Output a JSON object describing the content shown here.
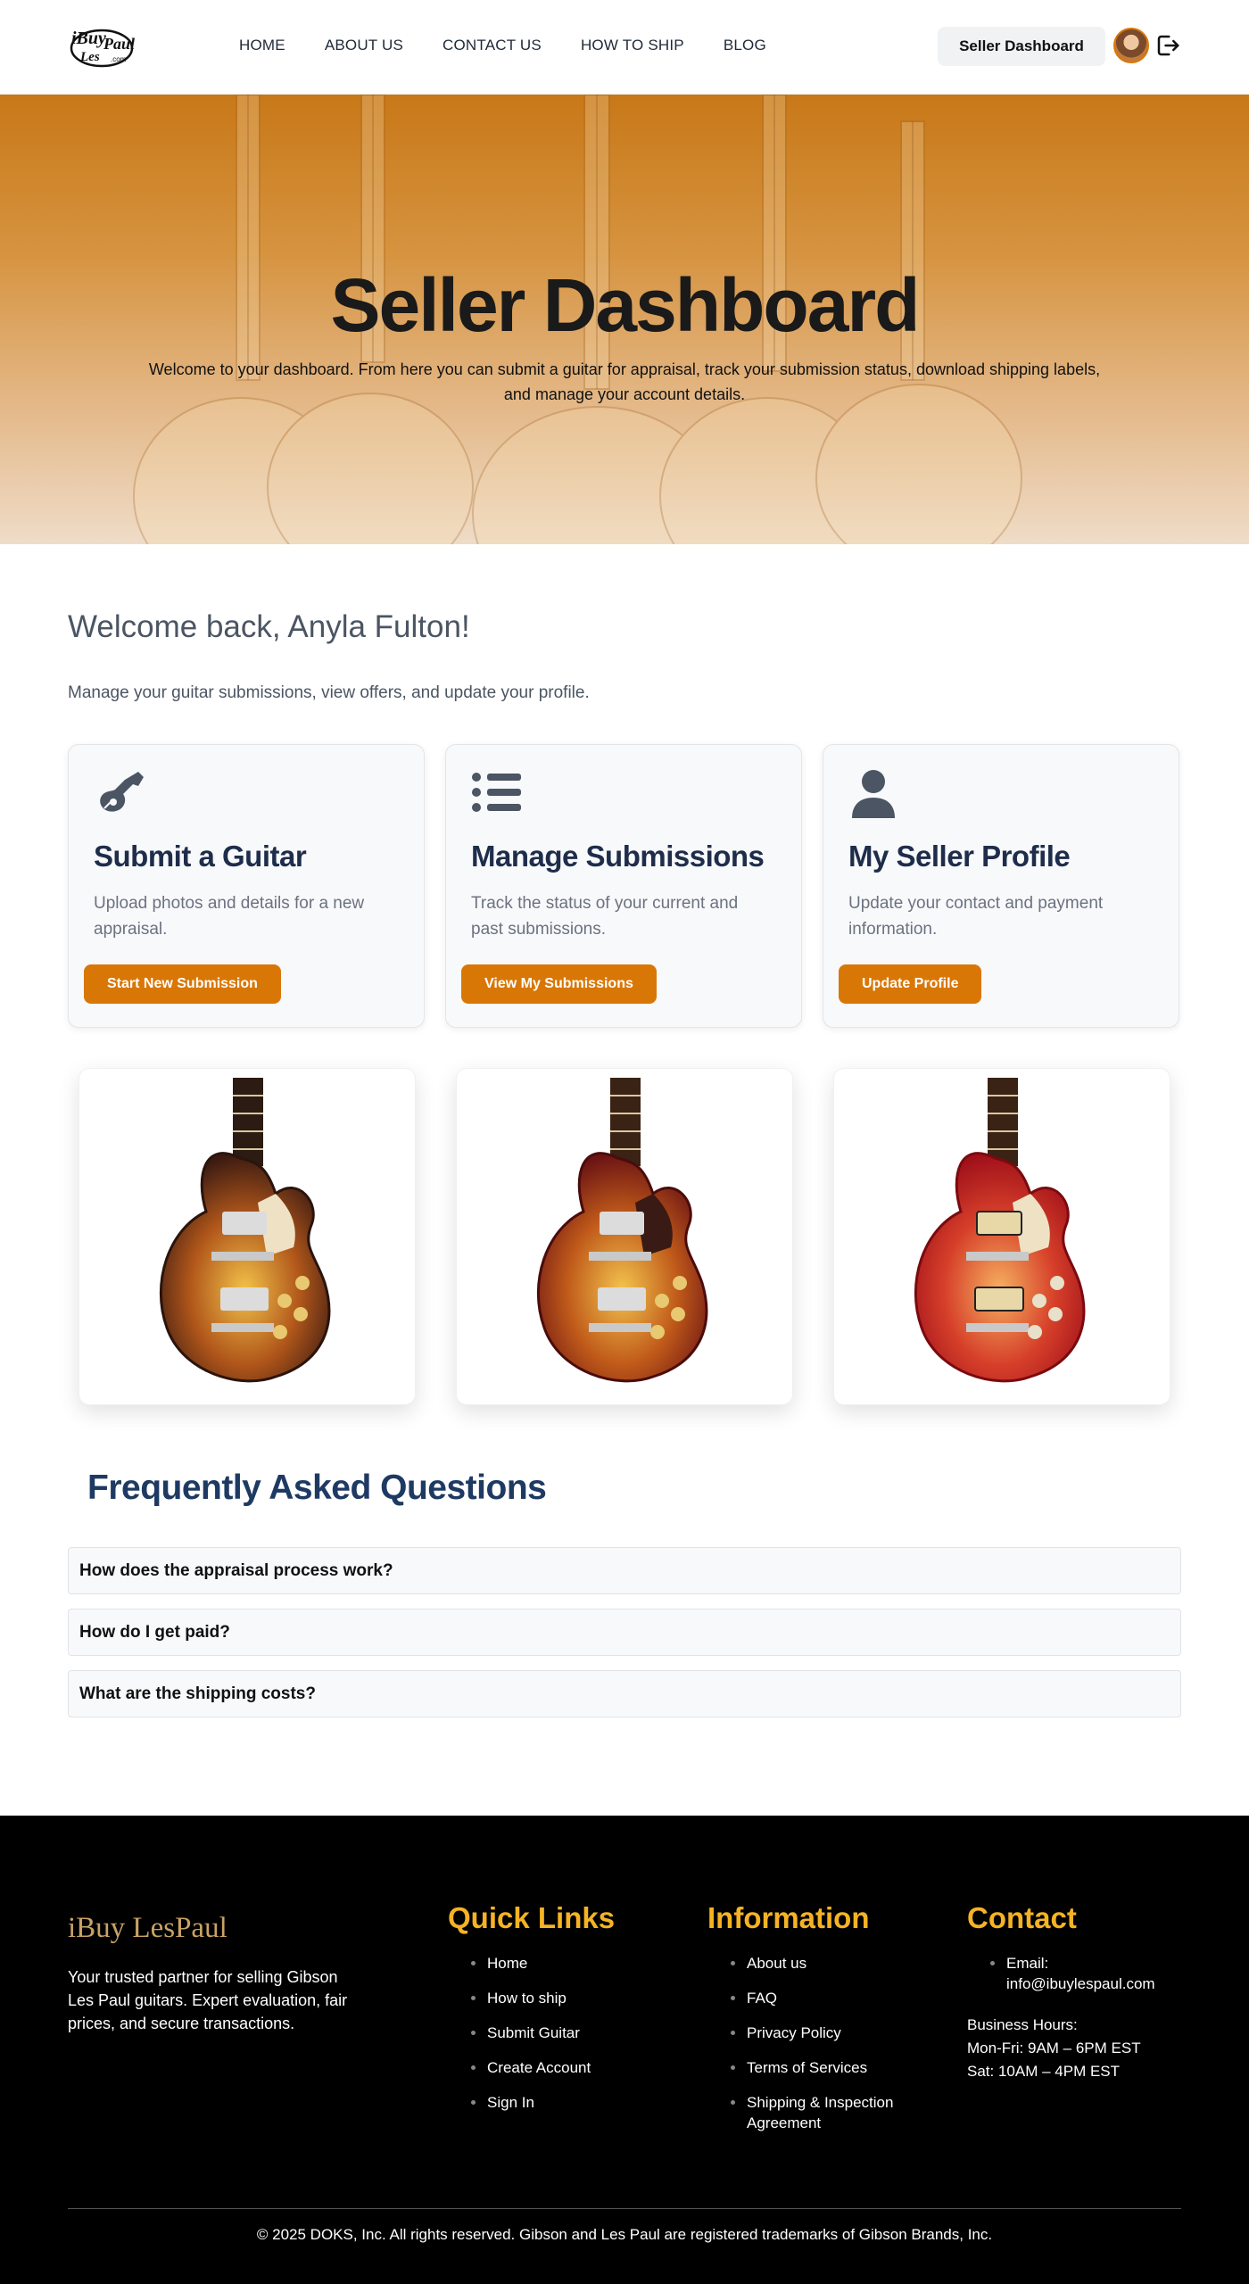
{
  "header": {
    "logo_text": "iBuy Les Paul .com",
    "nav": [
      "HOME",
      "ABOUT US",
      "CONTACT US",
      "HOW TO SHIP",
      "BLOG"
    ],
    "dashboard_button": "Seller Dashboard",
    "icons": [
      "avatar",
      "logout-icon"
    ]
  },
  "hero": {
    "title": "Seller Dashboard",
    "subtitle": "Welcome to your dashboard. From here you can submit a guitar for appraisal, track your submission status, download shipping labels, and manage your account details."
  },
  "welcome": {
    "heading": "Welcome back, Anyla Fulton!",
    "subtext": "Manage your guitar submissions, view offers, and update your profile."
  },
  "cards": [
    {
      "icon": "guitar-icon",
      "title": "Submit a Guitar",
      "text": "Upload photos and details for a new appraisal.",
      "button": "Start New Submission"
    },
    {
      "icon": "list-icon",
      "title": "Manage Submissions",
      "text": "Track the status of your current and past submissions.",
      "button": "View My Submissions"
    },
    {
      "icon": "user-icon",
      "title": "My Seller Profile",
      "text": "Update your contact and payment information.",
      "button": "Update Profile"
    }
  ],
  "guitars": [
    {
      "icon": "les-paul-tobacco-burst-image",
      "colors": {
        "edge": "#3a1a12",
        "mid": "#b0561a",
        "center": "#f2c24a"
      }
    },
    {
      "icon": "les-paul-bourbon-burst-image",
      "colors": {
        "edge": "#6b1414",
        "mid": "#c05a1a",
        "center": "#f3c44e"
      }
    },
    {
      "icon": "les-paul-cherry-sunburst-image",
      "colors": {
        "edge": "#a0101a",
        "mid": "#d6402a",
        "center": "#f6b060"
      }
    }
  ],
  "faq": {
    "title": "Frequently Asked Questions",
    "items": [
      "How does the appraisal process work?",
      "How do I get paid?",
      "What are the shipping costs?"
    ]
  },
  "footer": {
    "logo": "iBuy LesPaul",
    "tagline": "Your trusted partner for selling Gibson Les Paul guitars. Expert evaluation, fair prices, and secure transactions.",
    "quick_links": {
      "title": "Quick Links",
      "items": [
        "Home",
        "How to ship",
        "Submit Guitar",
        "Create Account",
        "Sign In"
      ]
    },
    "information": {
      "title": "Information",
      "items": [
        "About us",
        "FAQ",
        "Privacy Policy",
        "Terms of Services",
        "Shipping & Inspection Agreement"
      ]
    },
    "contact": {
      "title": "Contact",
      "email": "Email: info@ibuylespaul.com",
      "hours_label": "Business Hours:",
      "hours_weekday": "Mon-Fri: 9AM – 6PM EST",
      "hours_sat": "Sat: 10AM – 4PM EST"
    },
    "copyright": "© 2025 DOKS, Inc. All rights reserved. Gibson and Les Paul are registered trademarks of Gibson Brands, Inc."
  },
  "colors": {
    "accent": "#d97706",
    "heading_navy": "#1e2d4a",
    "footer_gold": "#f5b324"
  }
}
